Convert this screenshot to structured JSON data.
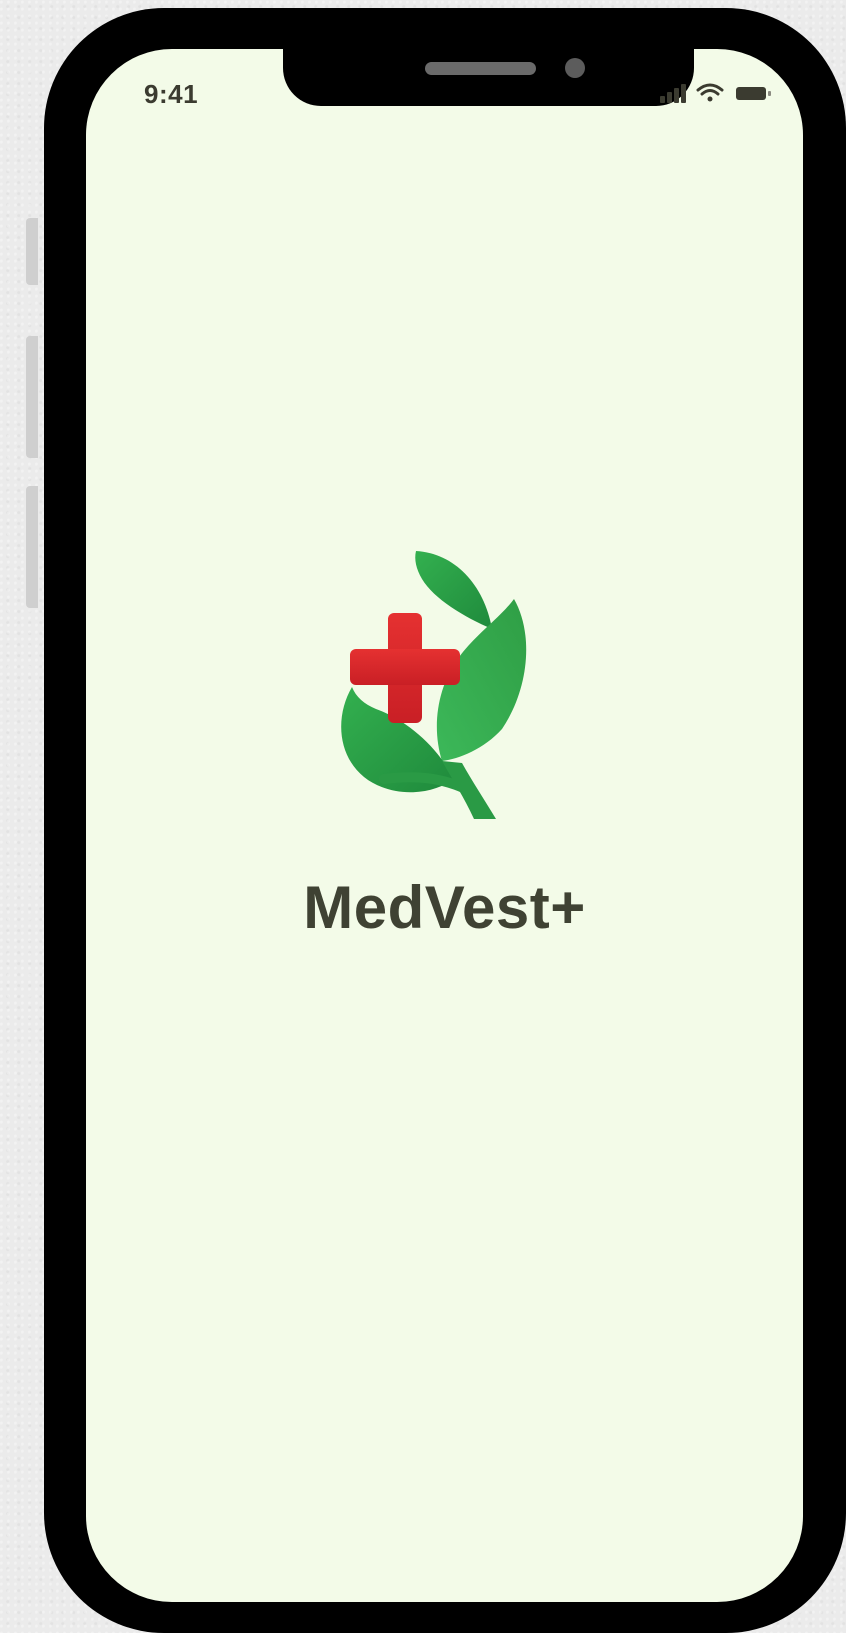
{
  "status_bar": {
    "time": "9:41",
    "icons": [
      "signal-icon",
      "wifi-icon",
      "battery-icon"
    ]
  },
  "splash": {
    "app_name": "MedVest+",
    "logo": "medical-cross-leaf-logo"
  },
  "colors": {
    "screen_background": "#f3fbe8",
    "text": "#3f4233",
    "cross_red": "#e12b2b",
    "leaf_green": "#2ea84a",
    "frame": "#000000"
  }
}
